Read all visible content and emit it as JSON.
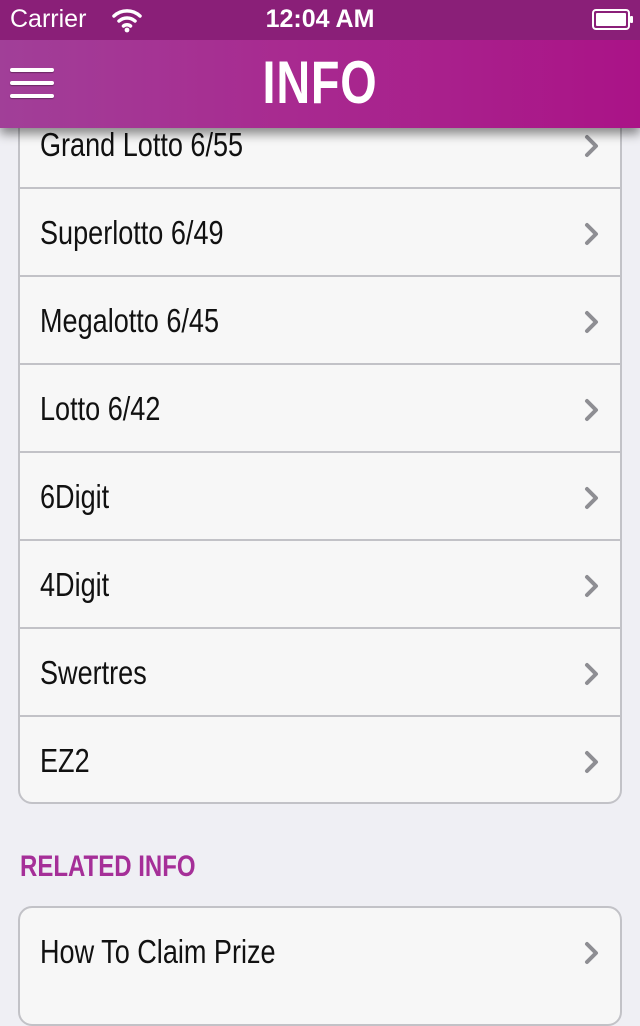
{
  "status_bar": {
    "carrier": "Carrier",
    "time": "12:04 AM",
    "wifi_icon": "wifi-icon",
    "battery_icon": "battery-icon"
  },
  "nav_bar": {
    "title": "INFO",
    "menu_icon": "hamburger-menu-icon",
    "background_color": "#a82a90"
  },
  "games": {
    "items": [
      {
        "label": "Grand Lotto 6/55"
      },
      {
        "label": "Superlotto 6/49"
      },
      {
        "label": "Megalotto 6/45"
      },
      {
        "label": "Lotto 6/42"
      },
      {
        "label": "6Digit"
      },
      {
        "label": "4Digit"
      },
      {
        "label": "Swertres"
      },
      {
        "label": "EZ2"
      }
    ],
    "chevron_icon": "chevron-right-icon"
  },
  "related": {
    "header": "RELATED INFO",
    "header_color": "#a52f98",
    "items": [
      {
        "label": "How To Claim Prize"
      }
    ]
  }
}
